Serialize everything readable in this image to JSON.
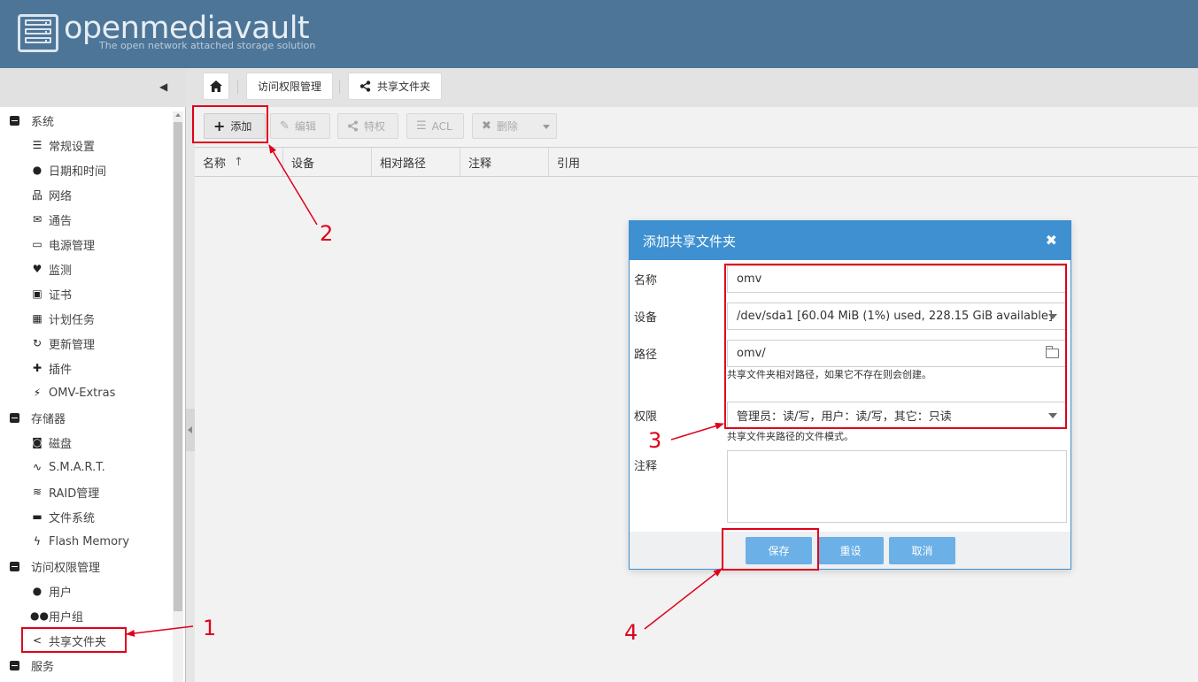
{
  "header": {
    "brand": "openmediavault",
    "tagline": "The open network attached storage solution"
  },
  "breadcrumb": {
    "home_icon": "home-icon",
    "items": [
      "访问权限管理",
      "共享文件夹"
    ]
  },
  "sidebar": {
    "groups": [
      {
        "label": "系统",
        "items": [
          {
            "label": "常规设置",
            "icon": "sliders-icon"
          },
          {
            "label": "日期和时间",
            "icon": "clock-icon"
          },
          {
            "label": "网络",
            "icon": "network-icon"
          },
          {
            "label": "通告",
            "icon": "envelope-icon"
          },
          {
            "label": "电源管理",
            "icon": "battery-icon"
          },
          {
            "label": "监测",
            "icon": "heartbeat-icon"
          },
          {
            "label": "证书",
            "icon": "certificate-icon"
          },
          {
            "label": "计划任务",
            "icon": "calendar-icon"
          },
          {
            "label": "更新管理",
            "icon": "refresh-icon"
          },
          {
            "label": "插件",
            "icon": "puzzle-icon"
          },
          {
            "label": "OMV-Extras",
            "icon": "plug-icon"
          }
        ]
      },
      {
        "label": "存储器",
        "items": [
          {
            "label": "磁盘",
            "icon": "disk-icon"
          },
          {
            "label": "S.M.A.R.T.",
            "icon": "pulse-icon"
          },
          {
            "label": "RAID管理",
            "icon": "database-icon"
          },
          {
            "label": "文件系统",
            "icon": "folder-icon"
          },
          {
            "label": "Flash Memory",
            "icon": "flash-icon"
          }
        ]
      },
      {
        "label": "访问权限管理",
        "items": [
          {
            "label": "用户",
            "icon": "user-icon"
          },
          {
            "label": "用户组",
            "icon": "users-icon"
          },
          {
            "label": "共享文件夹",
            "icon": "share-icon"
          }
        ]
      },
      {
        "label": "服务",
        "items": []
      }
    ]
  },
  "toolbar": {
    "add": "添加",
    "edit": "编辑",
    "privileges": "特权",
    "acl": "ACL",
    "delete": "删除"
  },
  "grid": {
    "columns": [
      "名称",
      "设备",
      "相对路径",
      "注释",
      "引用"
    ],
    "sort_indicator": "↑"
  },
  "dialog": {
    "title": "添加共享文件夹",
    "fields": {
      "name_label": "名称",
      "name_value": "omv",
      "device_label": "设备",
      "device_value": "/dev/sda1 [60.04 MiB (1%) used, 228.15 GiB available]",
      "path_label": "路径",
      "path_value": "omv/",
      "path_hint": "共享文件夹相对路径，如果它不存在则会创建。",
      "perm_label": "权限",
      "perm_value": "管理员：读/写，用户：读/写，其它：只读",
      "perm_hint": "共享文件夹路径的文件模式。",
      "comment_label": "注释"
    },
    "buttons": {
      "save": "保存",
      "reset": "重设",
      "cancel": "取消"
    }
  },
  "annotations": [
    "1",
    "2",
    "3",
    "4"
  ],
  "colors": {
    "header_bg": "#4d7597",
    "dialog_title_bg": "#3e90d0",
    "dialog_button": "#6bb0e6",
    "annotation_red": "#e0001b"
  }
}
